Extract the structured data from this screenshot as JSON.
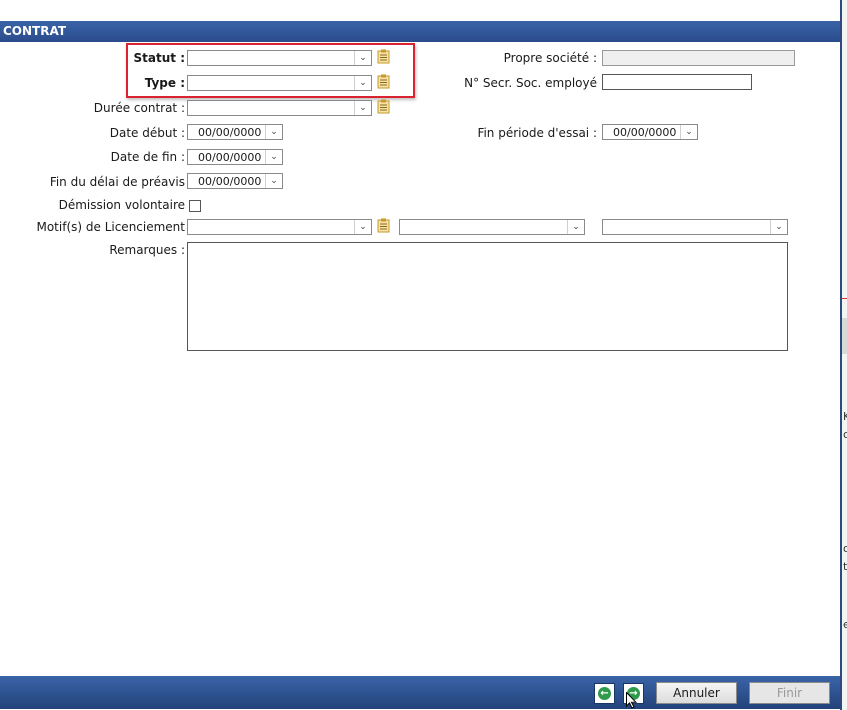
{
  "header": {
    "title": "CONTRAT"
  },
  "form": {
    "statut_label": "Statut :",
    "type_label": "Type :",
    "duree_label": "Durée contrat :",
    "date_debut_label": "Date début :",
    "date_debut_value": "00/00/0000",
    "date_fin_label": "Date de fin :",
    "date_fin_value": "00/00/0000",
    "preavis_label": "Fin du délai de préavis",
    "preavis_value": "00/00/0000",
    "demission_label": "Démission volontaire",
    "motifs_label": "Motif(s) de Licenciement",
    "remarques_label": "Remarques :",
    "propre_societe_label": "Propre société :",
    "secr_soc_label": "N° Secr. Soc. employé",
    "fin_essai_label": "Fin période d'essai :",
    "fin_essai_value": "00/00/0000"
  },
  "footer": {
    "annuler_label": "Annuler",
    "finir_label": "Finir"
  },
  "edge": {
    "t1": "K",
    "t2": "c",
    "t3": "o",
    "t4": "t",
    "t5": "e"
  },
  "colors": {
    "header_bg": "#2a4b8c",
    "highlight": "#d9232e",
    "nav_green": "#2f9a4a"
  }
}
